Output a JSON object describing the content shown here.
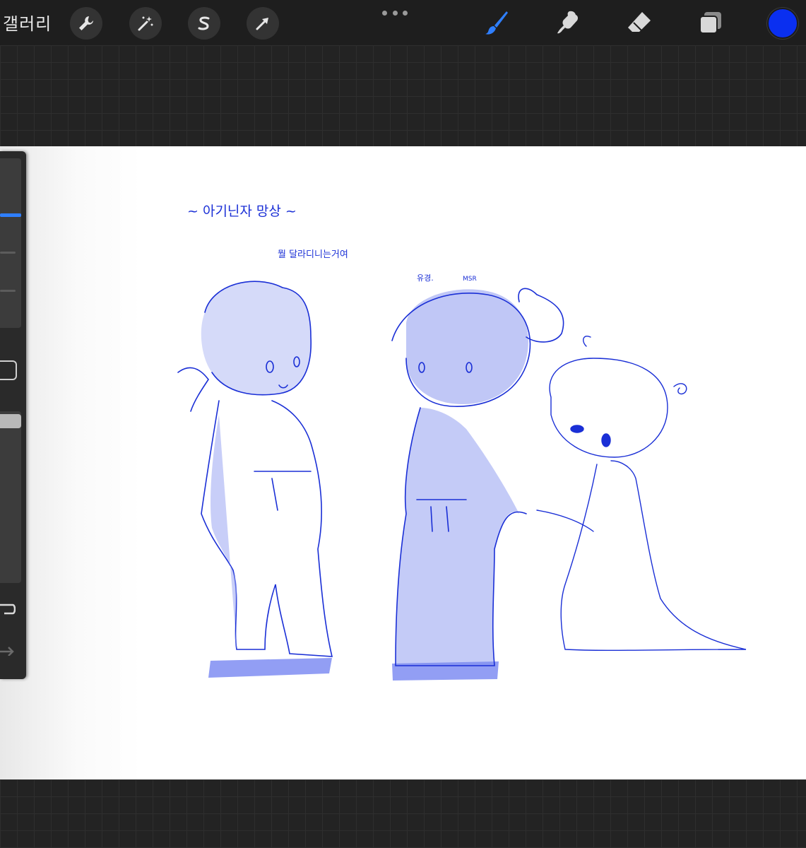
{
  "toolbar": {
    "gallery_label": "갤러리",
    "left_tools": [
      {
        "icon": "wrench-icon"
      },
      {
        "icon": "magic-wand-icon"
      },
      {
        "icon": "selection-icon"
      },
      {
        "icon": "transform-arrow-icon"
      }
    ],
    "more_icon": "more-dots-icon",
    "right_tools": [
      {
        "icon": "brush-icon",
        "active": true
      },
      {
        "icon": "smudge-icon"
      },
      {
        "icon": "eraser-icon"
      },
      {
        "icon": "layers-icon"
      }
    ],
    "current_color": "#0a2ff0"
  },
  "colors": {
    "active_tool": "#2f7fff",
    "ink": "#1a2fd6"
  },
  "canvas": {
    "title_text": "~ 아기닌자 망상 ~",
    "caption_1": "뭘 달라디니는거여",
    "caption_2": "유경.",
    "caption_3": "MSR"
  },
  "sidebar": {
    "undo_icon": "undo-icon",
    "redo_icon": "redo-icon",
    "modify_icon": "modify-square-icon"
  }
}
